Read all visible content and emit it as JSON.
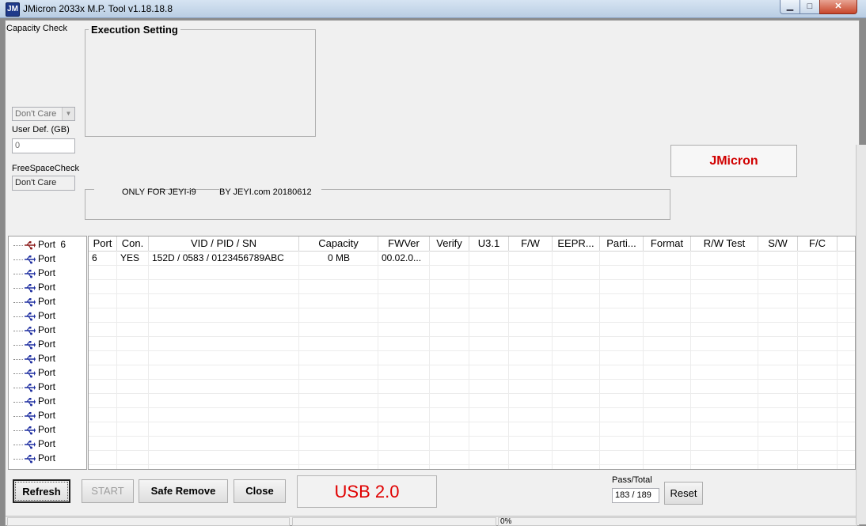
{
  "window": {
    "title": "JMicron 2033x M.P. Tool v1.18.18.8",
    "icon_letter": "JM",
    "min_glyph": "▁",
    "max_glyph": "□",
    "close_glyph": "✕"
  },
  "left_panel": {
    "capacity_check_label": "Capacity Check",
    "capacity_mode": "Don't Care",
    "user_def_label": "User Def. (GB)",
    "user_def_value": "0",
    "freespace_label": "FreeSpaceCheck",
    "freespace_value": "Don't Care"
  },
  "execution_setting": {
    "title": "Execution Setting"
  },
  "info_line": {
    "left": "ONLY FOR JEYI-i9",
    "right": "BY JEYI.com  20180612"
  },
  "brand_button": "JMicron",
  "tree": {
    "items": [
      {
        "label": "Port",
        "suffix": "6",
        "active": true
      },
      {
        "label": "Port",
        "suffix": ""
      },
      {
        "label": "Port",
        "suffix": ""
      },
      {
        "label": "Port",
        "suffix": ""
      },
      {
        "label": "Port",
        "suffix": ""
      },
      {
        "label": "Port",
        "suffix": ""
      },
      {
        "label": "Port",
        "suffix": ""
      },
      {
        "label": "Port",
        "suffix": ""
      },
      {
        "label": "Port",
        "suffix": ""
      },
      {
        "label": "Port",
        "suffix": ""
      },
      {
        "label": "Port",
        "suffix": ""
      },
      {
        "label": "Port",
        "suffix": ""
      },
      {
        "label": "Port",
        "suffix": ""
      },
      {
        "label": "Port",
        "suffix": ""
      },
      {
        "label": "Port",
        "suffix": ""
      },
      {
        "label": "Port",
        "suffix": ""
      }
    ]
  },
  "grid": {
    "columns": [
      "Port",
      "Con.",
      "VID / PID / SN",
      "Capacity",
      "FWVer",
      "Verify",
      "U3.1",
      "F/W",
      "EEPR...",
      "Parti...",
      "Format",
      "R/W Test",
      "S/W",
      "F/C"
    ],
    "rows": [
      [
        "6",
        "YES",
        "152D / 0583 / 0123456789ABC",
        "0 MB",
        "00.02.0...",
        "",
        "",
        "",
        "",
        "",
        "",
        "",
        "",
        ""
      ]
    ]
  },
  "buttons": {
    "refresh": "Refresh",
    "start": "START",
    "safe_remove": "Safe Remove",
    "close": "Close",
    "reset": "Reset"
  },
  "usb_mode": "USB 2.0",
  "pass_total": {
    "label": "Pass/Total",
    "value": "183 / 189"
  },
  "status": {
    "progress_text": "0%"
  },
  "colors": {
    "brand_red": "#d00000",
    "usb_red": "#e00000",
    "usb_blue": "#1f2fa0"
  }
}
